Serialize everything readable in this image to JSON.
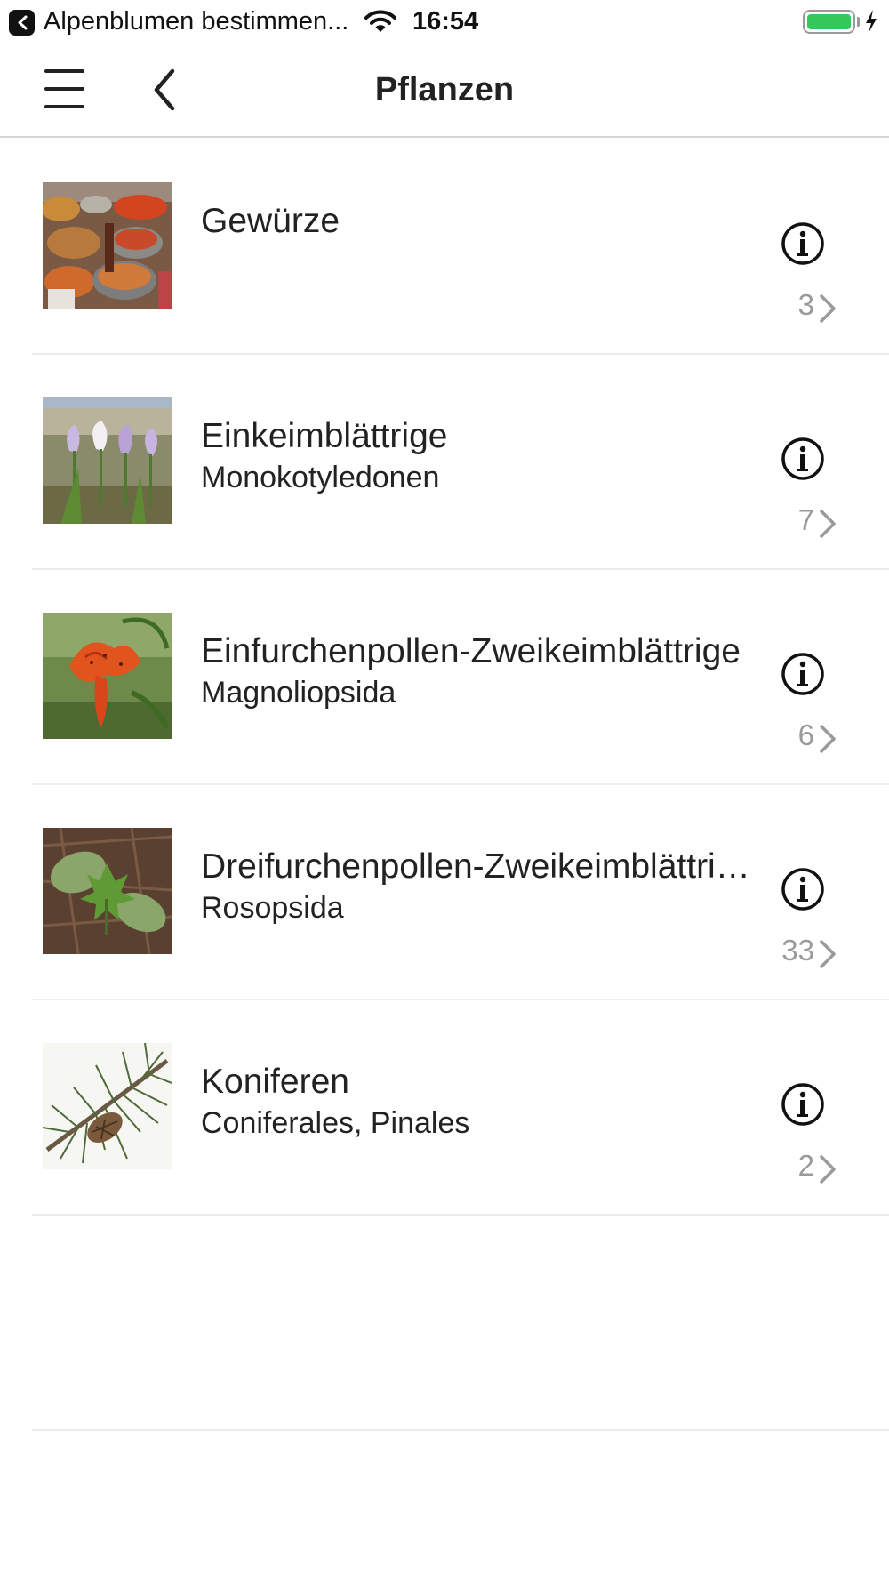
{
  "status_bar": {
    "back_app": "Alpenblumen bestimmen...",
    "time": "16:54",
    "icons": [
      "back-arrow-icon",
      "wifi-icon",
      "battery-icon",
      "charging-bolt-icon"
    ],
    "battery_color": "#34c759"
  },
  "nav": {
    "title": "Pflanzen",
    "menu_icon": "hamburger-menu-icon",
    "back_icon": "chevron-left-icon"
  },
  "items": [
    {
      "title": "Gewürze",
      "subtitle": "",
      "count": "3",
      "image": "spices-photo"
    },
    {
      "title": "Einkeimblättrige",
      "subtitle": "Monokotyledonen",
      "count": "7",
      "image": "crocus-photo"
    },
    {
      "title": "Einfurchenpollen-Zweikeimblättrige",
      "subtitle": "Magnoliopsida",
      "count": "6",
      "image": "lily-photo"
    },
    {
      "title": "Dreifurchenpollen-Zweikeimblättrige",
      "subtitle": "Rosopsida",
      "count": "33",
      "image": "seedling-photo"
    },
    {
      "title": "Koniferen",
      "subtitle": "Coniferales, Pinales",
      "count": "2",
      "image": "pine-cone-photo"
    }
  ],
  "row_icons": {
    "info": "info-circle-icon",
    "disclosure": "chevron-right-icon"
  },
  "colors": {
    "text": "#222222",
    "count": "#9a9a9a",
    "divider": "#ececec"
  }
}
